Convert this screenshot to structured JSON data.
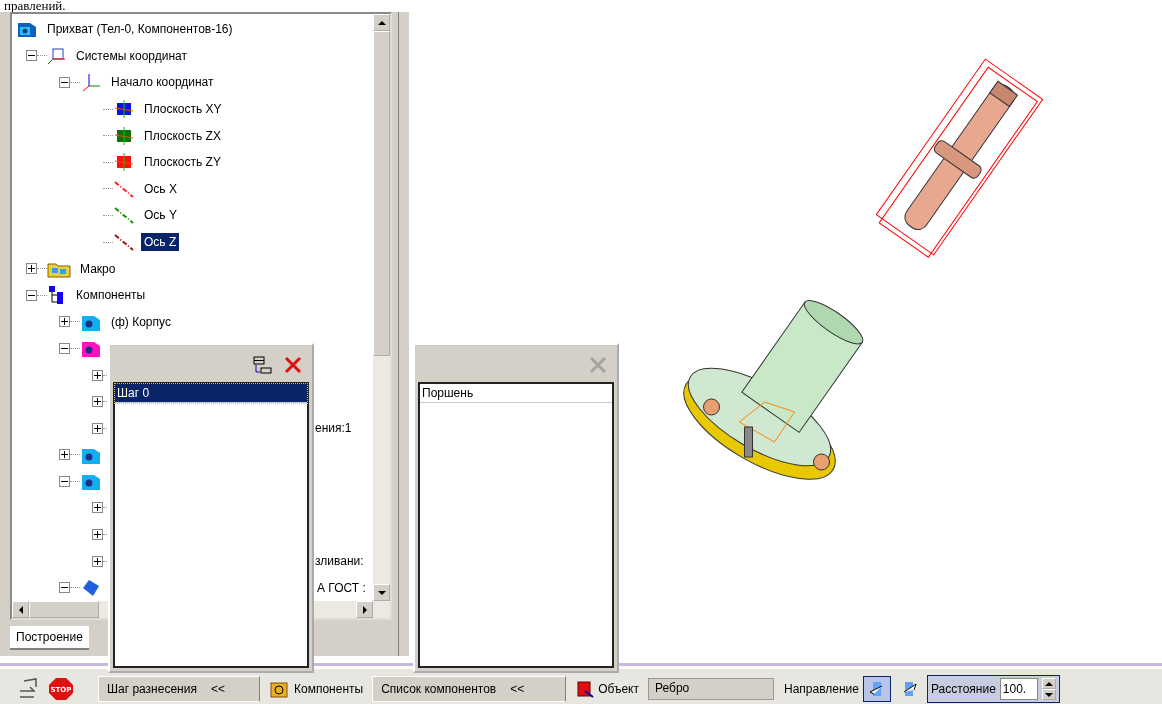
{
  "document_text": "правлений.",
  "tree": {
    "items": [
      {
        "kind": "assembly",
        "label": "Прихват (Тел-0, Компонентов-16)",
        "selected": false,
        "children": [
          {
            "kind": "coord-systems",
            "label": "Системы координат",
            "expanded": true,
            "selected": false,
            "children": [
              {
                "kind": "origin",
                "label": "Начало координат",
                "expanded": true,
                "selected": false,
                "children": [
                  {
                    "kind": "plane",
                    "label": "Плоскость XY",
                    "color": "#1010e0",
                    "selected": false
                  },
                  {
                    "kind": "plane",
                    "label": "Плоскость ZX",
                    "color": "#107010",
                    "selected": false
                  },
                  {
                    "kind": "plane",
                    "label": "Плоскость ZY",
                    "color": "#ff1010",
                    "selected": false
                  },
                  {
                    "kind": "axis",
                    "label": "Ось X",
                    "color": "#ff2020",
                    "selected": false
                  },
                  {
                    "kind": "axis",
                    "label": "Ось Y",
                    "color": "#109010",
                    "selected": false
                  },
                  {
                    "kind": "axis",
                    "label": "Ось Z",
                    "color": "#a01010",
                    "selected": true
                  }
                ]
              }
            ]
          },
          {
            "kind": "macro",
            "label": "Макро",
            "expanded": false,
            "selected": false
          },
          {
            "kind": "components",
            "label": "Компоненты",
            "expanded": true,
            "selected": false,
            "children": [
              {
                "kind": "part",
                "label": "(ф) Корпус",
                "color": "#10b0f0",
                "expanded": false,
                "selected": false
              },
              {
                "kind": "part",
                "color": "#ff10c0",
                "expanded": true,
                "children": [
                  {
                    "kind": "covered",
                    "expanded": false
                  },
                  {
                    "kind": "covered",
                    "expanded": false
                  },
                  {
                    "kind": "covered",
                    "label": "ения:1",
                    "cut": true,
                    "expanded": false,
                    "selected": false
                  }
                ]
              },
              {
                "kind": "part",
                "color": "#10b0f0",
                "expanded": false
              },
              {
                "kind": "part",
                "color": "#10b0f0",
                "expanded": true,
                "children": [
                  {
                    "kind": "covered",
                    "expanded": false
                  },
                  {
                    "kind": "covered",
                    "expanded": false
                  },
                  {
                    "kind": "covered",
                    "label": "зливани:",
                    "cut": true,
                    "expanded": false,
                    "selected": false
                  }
                ]
              },
              {
                "kind": "standard",
                "label": "А ГОСТ :",
                "cut": true,
                "expanded": true,
                "selected": false
              }
            ]
          }
        ]
      }
    ]
  },
  "left_tab": {
    "label": "Построение"
  },
  "steps_panel": {
    "tools": [
      {
        "kind": "arrange",
        "disabled": false
      },
      {
        "kind": "close",
        "disabled": false
      }
    ],
    "items": [
      {
        "label": "Шаг 0",
        "selected": true
      }
    ]
  },
  "components_panel": {
    "tools": [
      {
        "kind": "close",
        "disabled": true
      }
    ],
    "items": [
      {
        "label": "Поршень",
        "selected": false
      }
    ]
  },
  "toolbar": {
    "actions": [
      {
        "kind": "exit"
      },
      {
        "kind": "stop",
        "label": "STOP"
      }
    ],
    "step_tab": {
      "label": "Шаг разнесения",
      "chevron": "<<"
    },
    "components_button": {
      "label": "Компоненты"
    },
    "list_tab": {
      "label": "Список компонентов",
      "chevron": "<<"
    },
    "object": {
      "label": "Объект",
      "value": "Ребро"
    },
    "direction": {
      "label": "Направление",
      "options": [
        {
          "selected": true
        },
        {
          "selected": false
        }
      ]
    },
    "distance": {
      "label": "Расстояние",
      "value": "100."
    }
  }
}
